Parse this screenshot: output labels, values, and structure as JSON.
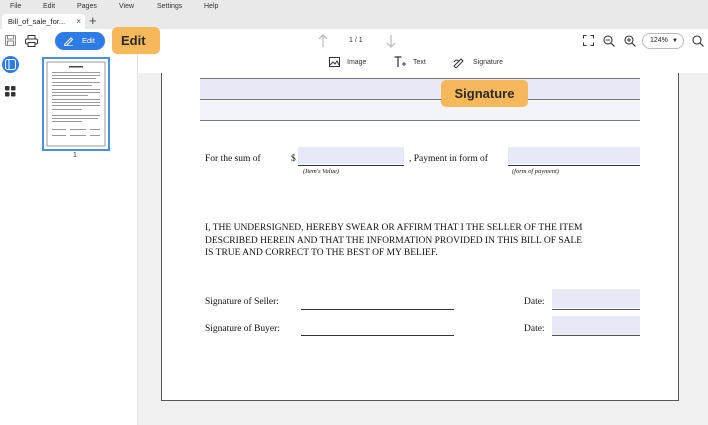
{
  "menu": [
    "File",
    "Edit",
    "Pages",
    "View",
    "Settings",
    "Help"
  ],
  "tab": {
    "title": "Bill_of_sale_for...",
    "close": "×",
    "new": "+"
  },
  "toolbar": {
    "edit_label": "Edit",
    "page_indicator": "1 / 1",
    "zoom": "124%"
  },
  "subtoolbar": {
    "image": "Image",
    "text": "Text",
    "signature": "Signature"
  },
  "thumbnail": {
    "page_number": "1"
  },
  "callouts": {
    "edit": "Edit",
    "signature": "Signature"
  },
  "document": {
    "sum_label": "For the sum of",
    "dollar": "$",
    "payment_label": ", Payment in form of",
    "items_value_caption": "(Item's Value)",
    "form_of_payment_caption": "(form of payment)",
    "affirmation_line1": "I, THE UNDERSIGNED, HEREBY SWEAR OR AFFIRM THAT I THE SELLER OF THE ITEM",
    "affirmation_line2": "DESCRIBED HEREIN AND THAT THE INFORMATION PROVIDED IN THIS BILL OF SALE",
    "affirmation_line3": "IS TRUE AND CORRECT TO THE BEST OF MY BELIEF.",
    "seller_sig_label": "Signature of Seller:",
    "buyer_sig_label": "Signature of Buyer:",
    "date_label_1": "Date:",
    "date_label_2": "Date:"
  },
  "colors": {
    "accent": "#2f7be5",
    "callout": "#f6b85b",
    "field": "#e7eaf6"
  }
}
